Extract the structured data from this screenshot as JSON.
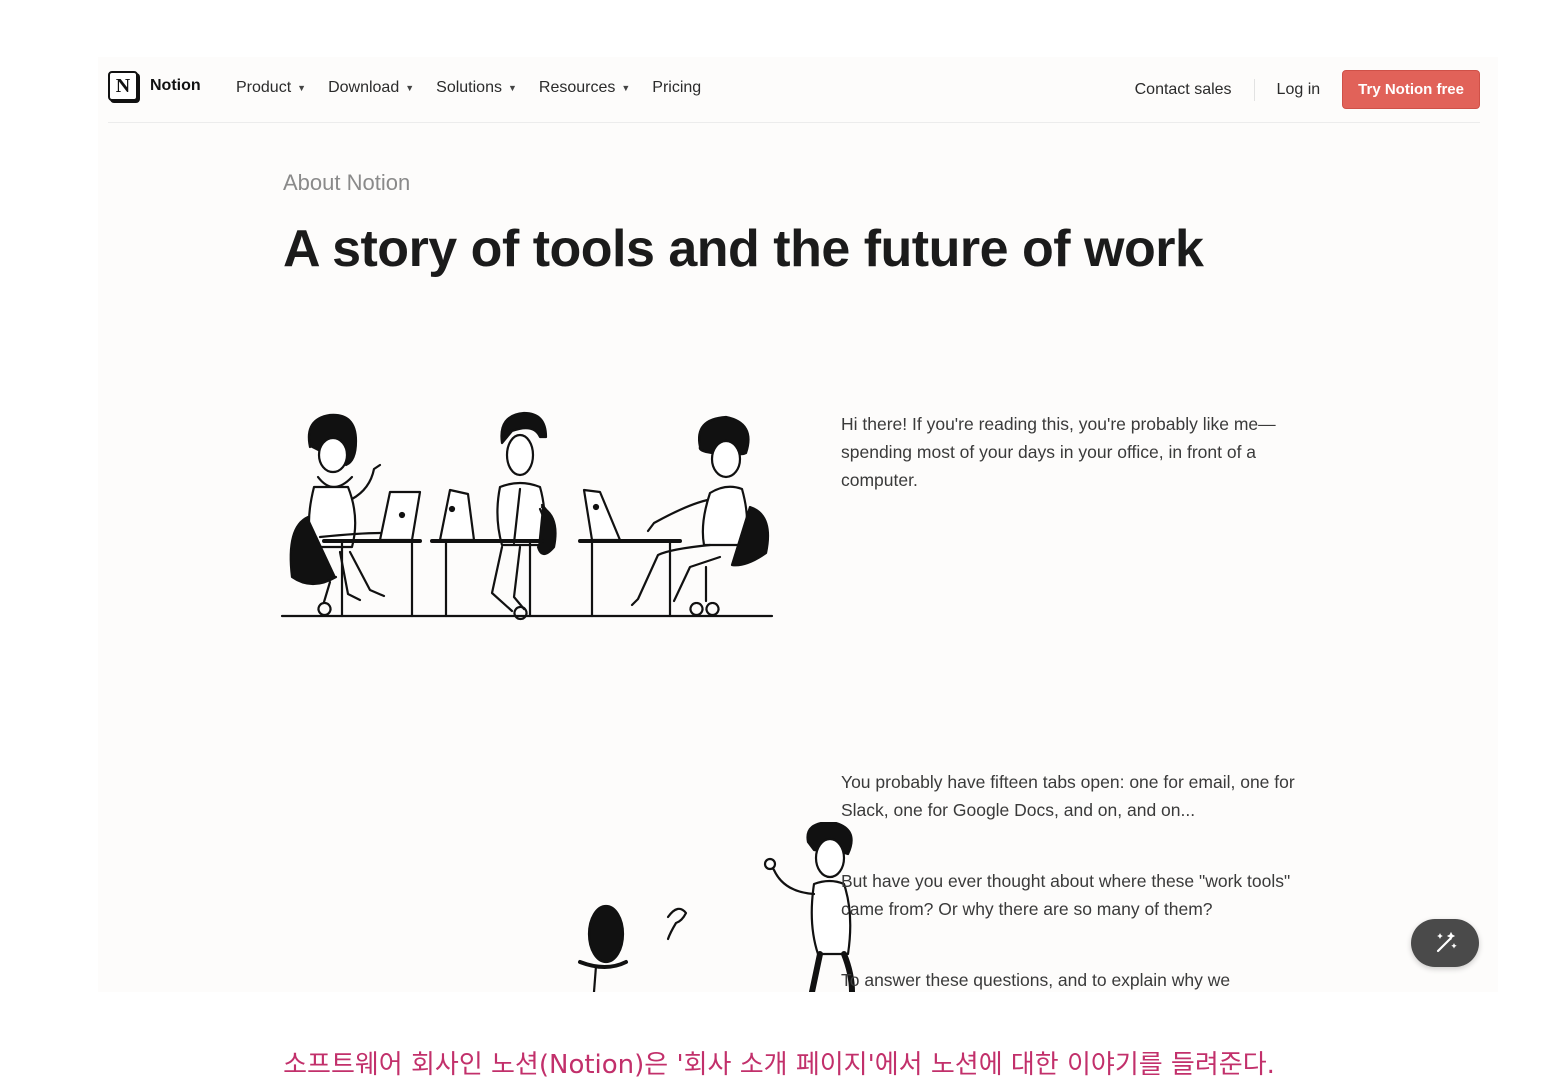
{
  "nav": {
    "brand": "Notion",
    "logo_letter": "N",
    "menu": [
      {
        "label": "Product",
        "has_dropdown": true
      },
      {
        "label": "Download",
        "has_dropdown": true
      },
      {
        "label": "Solutions",
        "has_dropdown": true
      },
      {
        "label": "Resources",
        "has_dropdown": true
      },
      {
        "label": "Pricing",
        "has_dropdown": false
      }
    ],
    "contact_sales": "Contact sales",
    "login": "Log in",
    "cta": "Try Notion free",
    "cta_color": "#e16259"
  },
  "main": {
    "eyebrow": "About Notion",
    "headline": "A story of tools and the future of work",
    "paragraphs": [
      "Hi there! If you're reading this, you're probably like me—spending most of your days in your office, in front of a computer.",
      "You probably have fifteen tabs open: one for email, one for Slack, one for Google Docs, and on, and on...",
      "But have you ever thought about where these \"work tools\" came from? Or why there are so many of them?",
      "To answer these questions, and to explain why we"
    ],
    "illustrations": [
      "three-people-at-desks-illustration",
      "person-with-chair-illustration"
    ]
  },
  "fab": {
    "icon": "magic-wand-icon"
  },
  "caption": "소프트웨어 회사인 노션(Notion)은 '회사 소개 페이지'에서 노션에 대한 이야기를 들려준다."
}
